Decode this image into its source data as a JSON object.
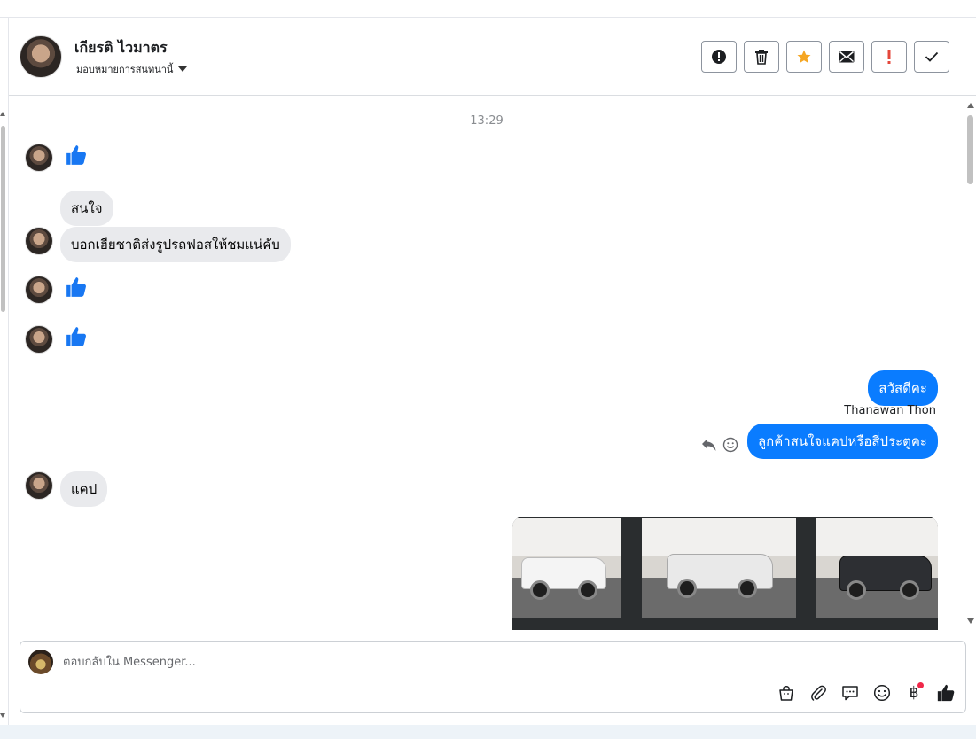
{
  "header": {
    "contact_name": "เกียรติ ไวมาตร",
    "assignment_label": "มอบหมายการสนทนานี้",
    "actions": [
      {
        "name": "report-icon"
      },
      {
        "name": "trash-icon"
      },
      {
        "name": "star-icon",
        "color": "#f5a623"
      },
      {
        "name": "envelope-icon"
      },
      {
        "name": "important-icon",
        "color": "#e4473b"
      },
      {
        "name": "checkmark-icon"
      }
    ]
  },
  "conversation": {
    "timestamp": "13:29",
    "incoming_texts": [
      "สนใจ",
      "บอกเฮียชาติส่งรูปรถฟอสให้ชมแน่คับ",
      "แคป"
    ],
    "outgoing": [
      {
        "text": "สวัสดีคะ",
        "sender": "Thanawan Thon"
      },
      {
        "text": "ลูกค้าสนใจแคปหรือสี่ประตูคะ"
      }
    ]
  },
  "composer": {
    "placeholder": "ตอบกลับใน Messenger...",
    "tools": [
      "bag-icon",
      "paperclip-icon",
      "quick-reply-icon",
      "emoji-icon",
      "baht-icon",
      "like-icon"
    ],
    "baht_symbol": "฿"
  },
  "colors": {
    "outgoing_bubble": "#0a7cff",
    "incoming_bubble": "#e9eaed",
    "like_blue": "#1877f2"
  }
}
